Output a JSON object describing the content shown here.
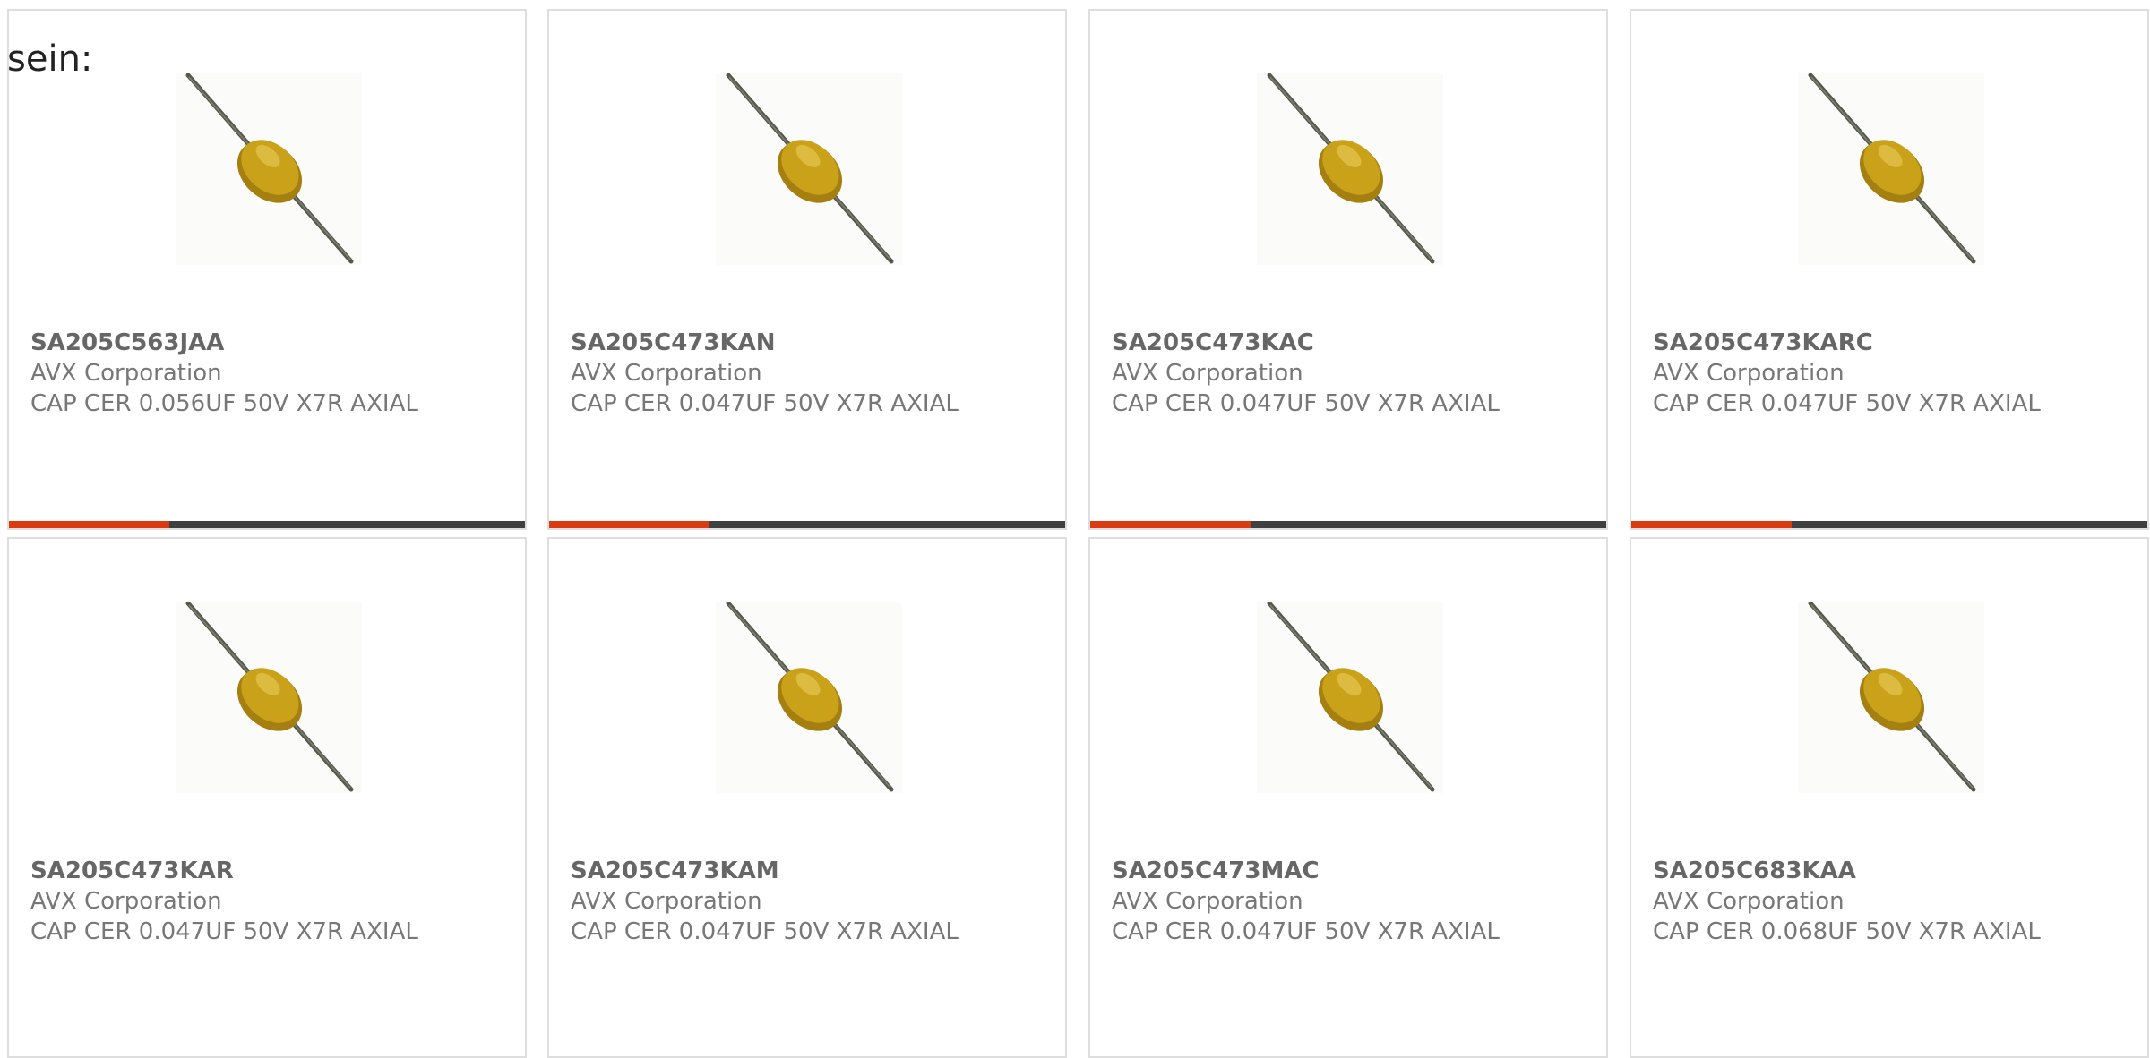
{
  "intro_text": "sein:",
  "colors": {
    "accent": "#dc3a10",
    "bar_track": "#404040",
    "border": "#dedede",
    "part_number_text": "#666666",
    "body_text": "#777777",
    "capacitor_body": "#c9a21a",
    "lead_wire": "#55584a"
  },
  "product_image_icon": "axial-ceramic-capacitor-icon",
  "cards": [
    {
      "part_number": "SA205C563JAA",
      "manufacturer": "AVX Corporation",
      "description": "CAP CER 0.056UF 50V X7R AXIAL",
      "progress": 0.31
    },
    {
      "part_number": "SA205C473KAN",
      "manufacturer": "AVX Corporation",
      "description": "CAP CER 0.047UF 50V X7R AXIAL",
      "progress": 0.31
    },
    {
      "part_number": "SA205C473KAC",
      "manufacturer": "AVX Corporation",
      "description": "CAP CER 0.047UF 50V X7R AXIAL",
      "progress": 0.31
    },
    {
      "part_number": "SA205C473KARC",
      "manufacturer": "AVX Corporation",
      "description": "CAP CER 0.047UF 50V X7R AXIAL",
      "progress": 0.31
    },
    {
      "part_number": "SA205C473KAR",
      "manufacturer": "AVX Corporation",
      "description": "CAP CER 0.047UF 50V X7R AXIAL",
      "progress": null
    },
    {
      "part_number": "SA205C473KAM",
      "manufacturer": "AVX Corporation",
      "description": "CAP CER 0.047UF 50V X7R AXIAL",
      "progress": null
    },
    {
      "part_number": "SA205C473MAC",
      "manufacturer": "AVX Corporation",
      "description": "CAP CER 0.047UF 50V X7R AXIAL",
      "progress": null
    },
    {
      "part_number": "SA205C683KAA",
      "manufacturer": "AVX Corporation",
      "description": "CAP CER 0.068UF 50V X7R AXIAL",
      "progress": null
    }
  ]
}
